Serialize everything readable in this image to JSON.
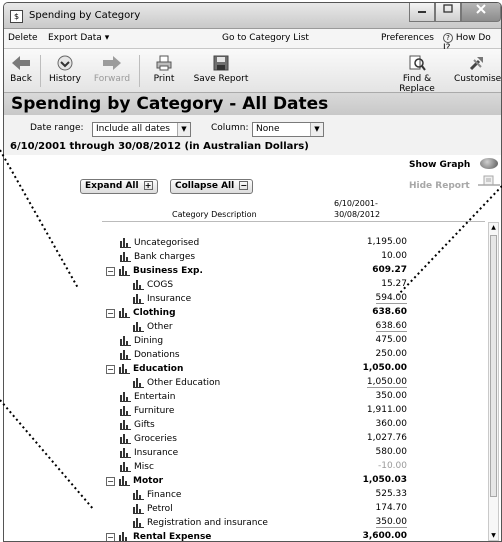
{
  "window": {
    "title": "Spending by Category",
    "app_icon": "$",
    "controls": [
      "minimize",
      "maximize",
      "close"
    ]
  },
  "menu": {
    "delete": "Delete",
    "export": "Export Data",
    "goto": "Go to Category List",
    "preferences": "Preferences",
    "help": "How Do I?"
  },
  "toolbar": {
    "back": "Back",
    "history": "History",
    "forward": "Forward",
    "print": "Print",
    "save": "Save Report",
    "find": "Find & Replace",
    "customise": "Customise"
  },
  "report": {
    "title": "Spending by Category - All Dates",
    "date_range_label": "Date range:",
    "date_range_value": "Include all dates",
    "column_label": "Column:",
    "column_value": "None",
    "period": "6/10/2001 through 30/08/2012 (in Australian Dollars)",
    "show_graph": "Show Graph",
    "hide_report": "Hide Report",
    "expand_all": "Expand All",
    "collapse_all": "Collapse All",
    "col_category": "Category Description",
    "col_date_1": "6/10/2001-",
    "col_date_2": "30/08/2012"
  },
  "rows": [
    {
      "name": "Uncategorised",
      "amount": "1,195.00",
      "level": 0
    },
    {
      "name": "Bank charges",
      "amount": "10.00",
      "level": 0
    },
    {
      "name": "Business Exp.",
      "amount": "609.27",
      "level": 0,
      "toggle": true,
      "bold": true
    },
    {
      "name": "COGS",
      "amount": "15.27",
      "level": 1
    },
    {
      "name": "Insurance",
      "amount": "594.00",
      "level": 1,
      "sub": true
    },
    {
      "name": "Clothing",
      "amount": "638.60",
      "level": 0,
      "toggle": true,
      "bold": true
    },
    {
      "name": "Other",
      "amount": "638.60",
      "level": 1,
      "sub": true
    },
    {
      "name": "Dining",
      "amount": "475.00",
      "level": 0
    },
    {
      "name": "Donations",
      "amount": "250.00",
      "level": 0
    },
    {
      "name": "Education",
      "amount": "1,050.00",
      "level": 0,
      "toggle": true,
      "bold": true
    },
    {
      "name": "Other Education",
      "amount": "1,050.00",
      "level": 1,
      "sub": true
    },
    {
      "name": "Entertain",
      "amount": "350.00",
      "level": 0
    },
    {
      "name": "Furniture",
      "amount": "1,911.00",
      "level": 0
    },
    {
      "name": "Gifts",
      "amount": "360.00",
      "level": 0
    },
    {
      "name": "Groceries",
      "amount": "1,027.76",
      "level": 0
    },
    {
      "name": "Insurance",
      "amount": "580.00",
      "level": 0
    },
    {
      "name": "Misc",
      "amount": "-10.00",
      "level": 0,
      "negative": true
    },
    {
      "name": "Motor",
      "amount": "1,050.03",
      "level": 0,
      "toggle": true,
      "bold": true
    },
    {
      "name": "Finance",
      "amount": "525.33",
      "level": 1
    },
    {
      "name": "Petrol",
      "amount": "174.70",
      "level": 1
    },
    {
      "name": "Registration and insurance",
      "amount": "350.00",
      "level": 1,
      "sub": true
    },
    {
      "name": "Rental Expense",
      "amount": "3,600.00",
      "level": 0,
      "toggle": true,
      "bold": true
    }
  ]
}
